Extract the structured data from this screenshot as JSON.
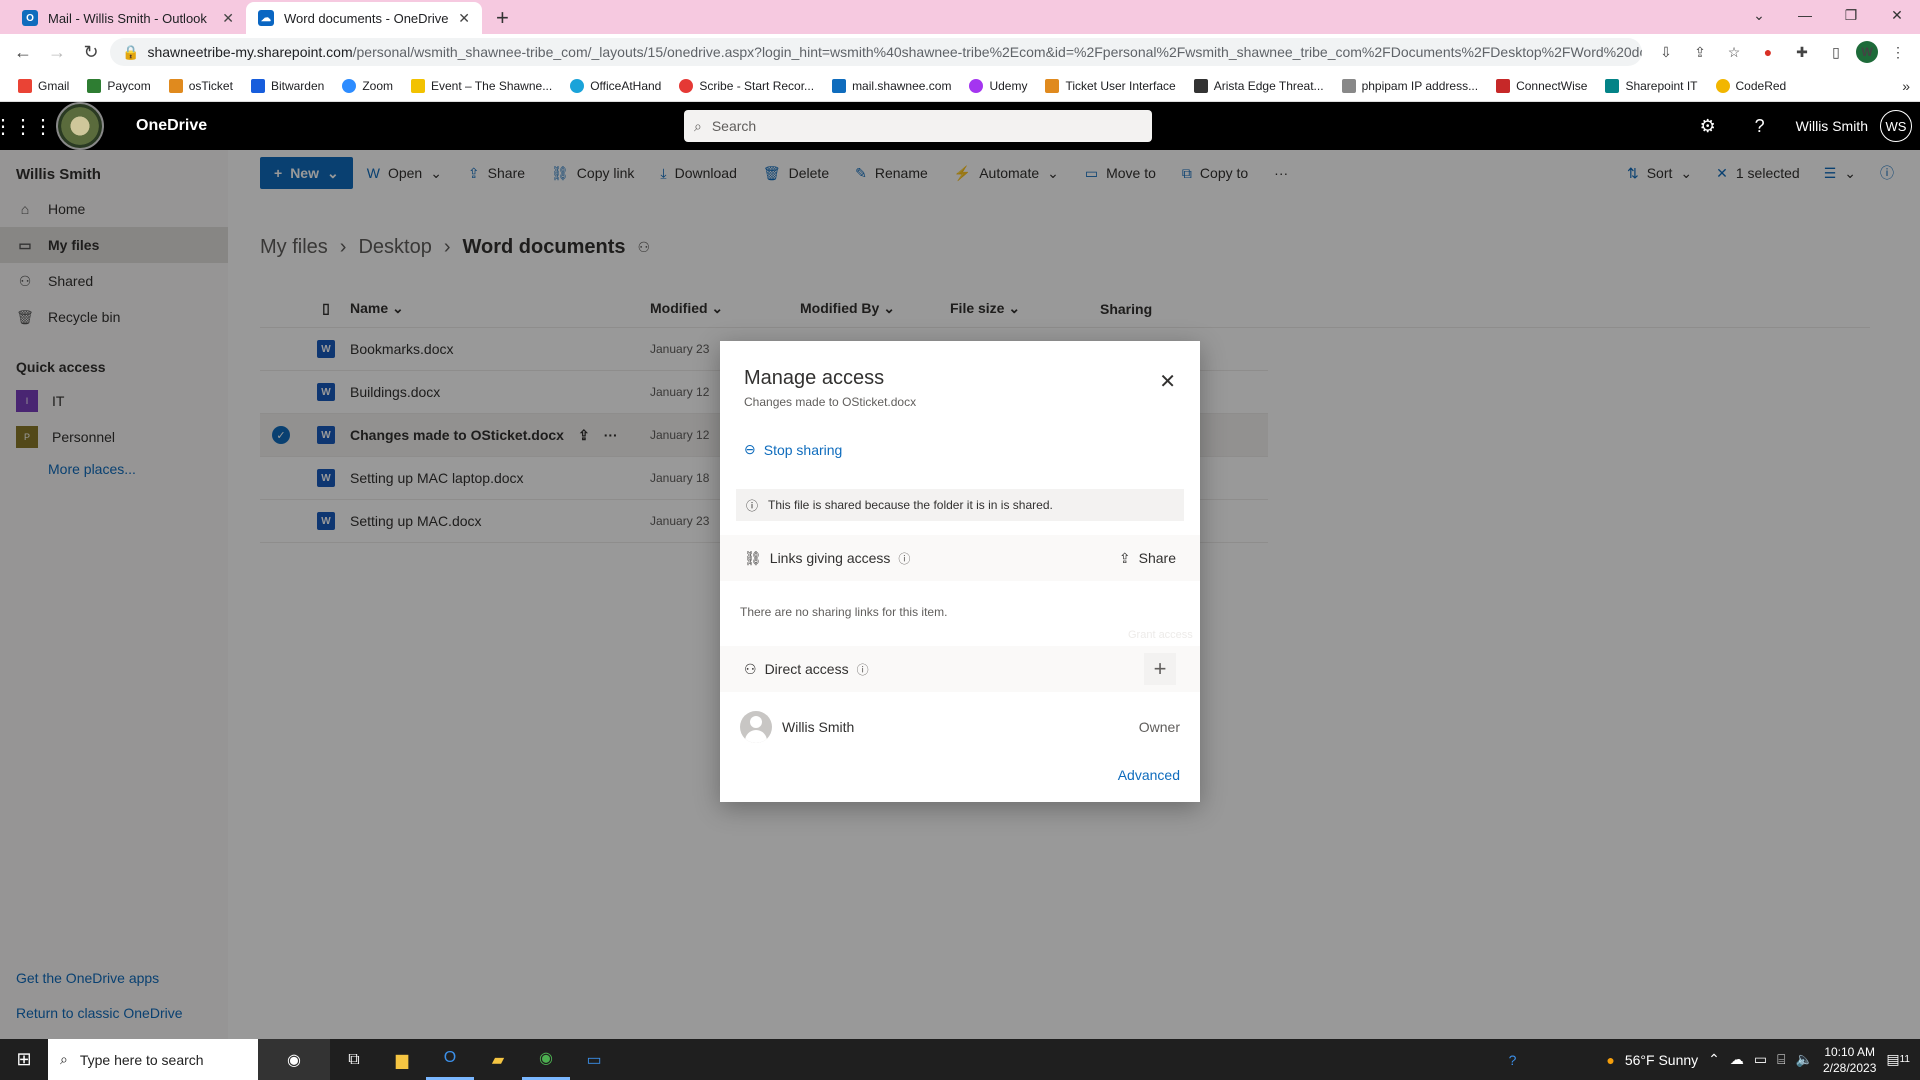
{
  "browser": {
    "tabs": [
      {
        "label": "Mail - Willis Smith - Outlook",
        "icon": "outlook-icon"
      },
      {
        "label": "Word documents - OneDrive",
        "icon": "onedrive-icon"
      }
    ],
    "url_domain": "shawneetribe-my.sharepoint.com",
    "url_path": "/personal/wsmith_shawnee-tribe_com/_layouts/15/onedrive.aspx?login_hint=wsmith%40shawnee-tribe%2Ecom&id=%2Fpersonal%2Fwsmith_shawnee_tribe_com%2FDocuments%2FDesktop%2FWord%20docu...",
    "profile_initial": "W",
    "bookmarks": [
      "Gmail",
      "Paycom",
      "osTicket",
      "Bitwarden",
      "Zoom",
      "Event – The Shawne...",
      "OfficeAtHand",
      "Scribe - Start Recor...",
      "mail.shawnee.com",
      "Udemy",
      "Ticket User Interface",
      "Arista Edge Threat...",
      "phpipam IP address...",
      "ConnectWise",
      "Sharepoint IT",
      "CodeRed"
    ]
  },
  "header": {
    "app_name": "OneDrive",
    "search_placeholder": "Search",
    "user_name": "Willis Smith",
    "user_initials": "WS"
  },
  "sidebar": {
    "user": "Willis Smith",
    "items": [
      "Home",
      "My files",
      "Shared",
      "Recycle bin"
    ],
    "quick_access_title": "Quick access",
    "quick_access": [
      "IT",
      "Personnel"
    ],
    "more_places": "More places...",
    "get_apps": "Get the OneDrive apps",
    "return_classic": "Return to classic OneDrive"
  },
  "commandbar": {
    "new": "New",
    "open": "Open",
    "share": "Share",
    "copy_link": "Copy link",
    "download": "Download",
    "delete": "Delete",
    "rename": "Rename",
    "automate": "Automate",
    "move_to": "Move to",
    "copy_to": "Copy to",
    "more": "···",
    "sort": "Sort",
    "selected": "1 selected"
  },
  "breadcrumb": {
    "root": "My files",
    "mid": "Desktop",
    "current": "Word documents"
  },
  "filelist": {
    "columns": {
      "name": "Name",
      "modified": "Modified",
      "modified_by": "Modified By",
      "file_size": "File size",
      "sharing": "Sharing"
    },
    "rows": [
      {
        "name": "Bookmarks.docx",
        "modified": "January 23"
      },
      {
        "name": "Buildings.docx",
        "modified": "January 12"
      },
      {
        "name": "Changes made to OSticket.docx",
        "modified": "January 12"
      },
      {
        "name": "Setting up MAC laptop.docx",
        "modified": "January 18"
      },
      {
        "name": "Setting up MAC.docx",
        "modified": "January 23"
      }
    ]
  },
  "dialog": {
    "title": "Manage access",
    "subtitle": "Changes made to OSticket.docx",
    "stop_sharing": "Stop sharing",
    "info": "This file is shared because the folder it is in is shared.",
    "links_title": "Links giving access",
    "share": "Share",
    "no_links": "There are no sharing links for this item.",
    "grant_access_tip": "Grant access",
    "direct_title": "Direct access",
    "person_name": "Willis Smith",
    "person_role": "Owner",
    "advanced": "Advanced"
  },
  "taskbar": {
    "search_placeholder": "Type here to search",
    "weather": "56°F  Sunny",
    "time": "10:10 AM",
    "date": "2/28/2023",
    "notification_count": "11"
  }
}
